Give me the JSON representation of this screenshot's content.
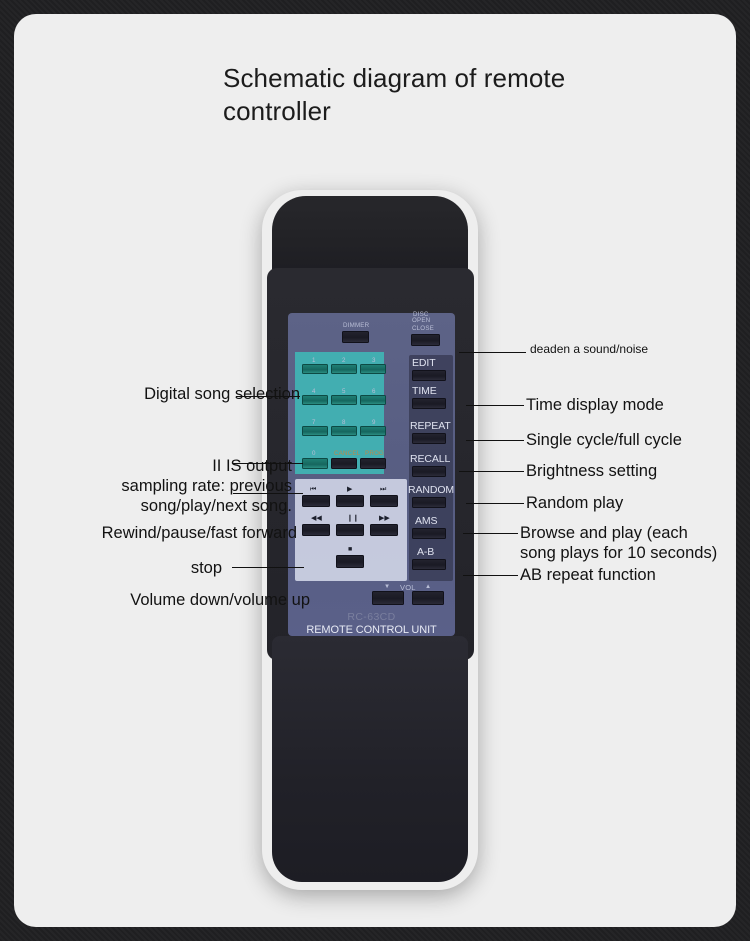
{
  "page": {
    "title": "Schematic diagram of remote\ncontroller",
    "frame_color": "#1a1a1c",
    "card_color": "#eeeeee"
  },
  "remote": {
    "faceplate_color": "#5d6387",
    "keypad_color": "#3dbfbb",
    "transport_color": "#cdd2e4",
    "accent_amber": "#b98a4e",
    "model": "RC-63CD",
    "unit_label": "REMOTE CONTROL UNIT",
    "top_labels": {
      "dimmer": "DIMMER",
      "disc": "DISC",
      "open_close_line1": "OPEN",
      "open_close_line2": "CLOSE"
    },
    "keypad": {
      "digits": [
        "1",
        "2",
        "3",
        "4",
        "5",
        "6",
        "7",
        "8",
        "9"
      ],
      "zero": "0",
      "cancel": "CANCEL",
      "prog": "PROG"
    },
    "right_column": [
      {
        "label": "EDIT"
      },
      {
        "label": "TIME"
      },
      {
        "label": "REPEAT"
      },
      {
        "label": "RECALL"
      },
      {
        "label": "RANDOM"
      },
      {
        "label": "AMS"
      },
      {
        "label": "A-B"
      }
    ],
    "transport": {
      "prev": "⏮",
      "play": "▶",
      "next": "⏭",
      "rewind": "◀◀",
      "pause": "❙❙",
      "forward": "▶▶",
      "stop": "■"
    },
    "volume": {
      "down": "▼",
      "label": "VOL",
      "up": "▲"
    }
  },
  "annotations": {
    "left": [
      {
        "id": "digital-song-selection",
        "text": "Digital song selection"
      },
      {
        "id": "iis-output",
        "text": "II IS output\nsampling rate: previous\nsong/play/next song."
      },
      {
        "id": "rewind-pause-ff",
        "text": "Rewind/pause/fast forward"
      },
      {
        "id": "stop",
        "text": "stop"
      },
      {
        "id": "volume",
        "text": "Volume down/volume up"
      }
    ],
    "right": [
      {
        "id": "deaden-sound",
        "text": "deaden a sound/noise"
      },
      {
        "id": "time-display-mode",
        "text": "Time display mode"
      },
      {
        "id": "single-full-cycle",
        "text": "Single cycle/full cycle"
      },
      {
        "id": "brightness-setting",
        "text": "Brightness setting"
      },
      {
        "id": "random-play",
        "text": "Random play"
      },
      {
        "id": "browse-and-play",
        "text": "Browse and play (each\nsong plays for 10 seconds)"
      },
      {
        "id": "ab-repeat",
        "text": "AB repeat function"
      }
    ]
  }
}
